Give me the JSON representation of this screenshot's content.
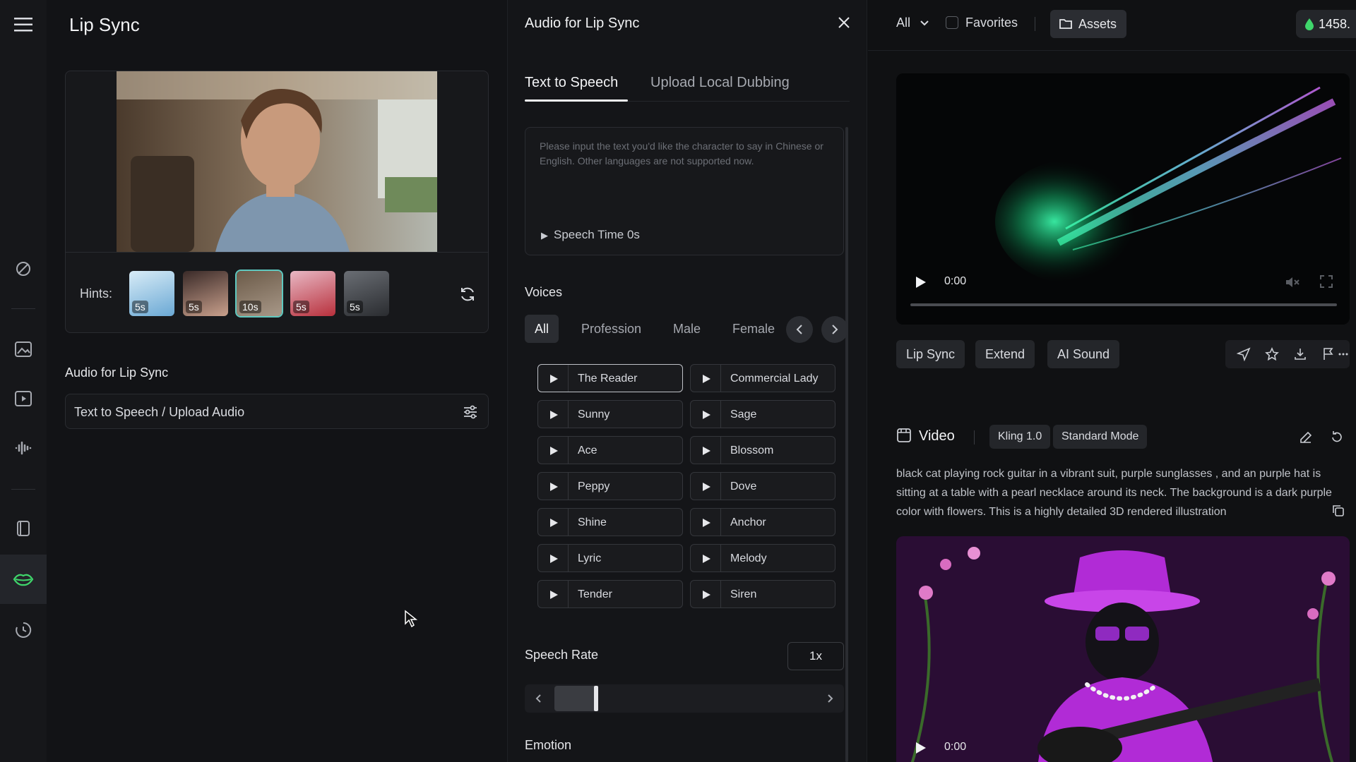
{
  "left_panel": {
    "title": "Lip Sync",
    "hints_label": "Hints:",
    "hint_thumbs": [
      {
        "duration": "5s"
      },
      {
        "duration": "5s"
      },
      {
        "duration": "10s"
      },
      {
        "duration": "5s"
      },
      {
        "duration": "5s"
      }
    ],
    "audio_label": "Audio for Lip Sync",
    "audio_field_text": "Text to Speech / Upload Audio"
  },
  "mid_panel": {
    "title": "Audio for Lip Sync",
    "tabs": [
      "Text to Speech",
      "Upload Local Dubbing"
    ],
    "placeholder": "Please input the text you'd like the character to say in Chinese or English. Other languages are not supported now.",
    "speech_time": "Speech Time 0s",
    "voices_label": "Voices",
    "filters": [
      "All",
      "Profession",
      "Male",
      "Female"
    ],
    "voices_left": [
      "The Reader",
      "Sunny",
      "Ace",
      "Peppy",
      "Shine",
      "Lyric",
      "Tender"
    ],
    "voices_right": [
      "Commercial Lady",
      "Sage",
      "Blossom",
      "Dove",
      "Anchor",
      "Melody",
      "Siren"
    ],
    "speech_rate_label": "Speech Rate",
    "speech_rate_value": "1x",
    "emotion_label": "Emotion"
  },
  "right_panel": {
    "filter_all": "All",
    "favorites": "Favorites",
    "assets": "Assets",
    "credits": "1458.",
    "video1_time": "0:00",
    "actions": [
      "Lip Sync",
      "Extend",
      "AI Sound"
    ],
    "video_heading": "Video",
    "model_badge": "Kling 1.0",
    "mode_badge": "Standard Mode",
    "prompt": "black cat playing rock guitar in a vibrant suit, purple sunglasses , and an purple hat is sitting at a table with a pearl necklace around its neck. The background is a dark purple color with flowers. This is a highly detailed 3D rendered illustration",
    "video2_time": "0:00"
  },
  "colors": {
    "accent": "#5fc9c0",
    "credit_icon": "#3fd66b",
    "cat_purple": "#b12bd6"
  }
}
